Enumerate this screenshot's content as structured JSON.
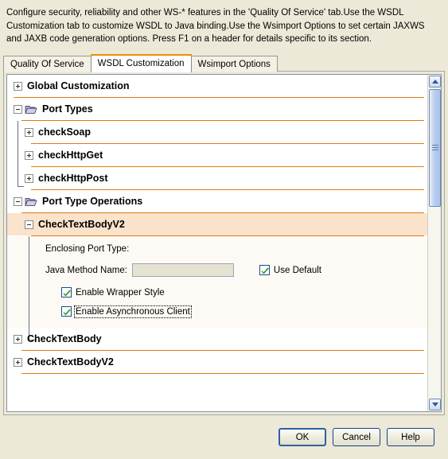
{
  "description": "Configure security, reliability and other WS-* features in the 'Quality Of Service' tab.Use the WSDL Customization tab to customize WSDL to Java binding.Use the Wsimport Options to set certain JAXWS and JAXB code generation options. Press F1 on a header for details specific to its section.",
  "tabs": [
    {
      "label": "Quality Of Service",
      "active": false
    },
    {
      "label": "WSDL Customization",
      "active": true
    },
    {
      "label": "Wsimport Options",
      "active": false
    }
  ],
  "tree": {
    "global_customization": "Global Customization",
    "port_types": "Port Types",
    "port_type_children": [
      "checkSoap",
      "checkHttpGet",
      "checkHttpPost"
    ],
    "port_type_operations": "Port Type Operations",
    "selected_operation": "CheckTextBodyV2",
    "operations_after": [
      "CheckTextBody",
      "CheckTextBodyV2"
    ]
  },
  "detail": {
    "enclosing_port_type_label": "Enclosing Port Type:",
    "enclosing_port_type_value": "",
    "java_method_name_label": "Java Method Name:",
    "java_method_name_value": "",
    "java_method_name_placeholder": "",
    "use_default_label": "Use Default",
    "use_default_checked": true,
    "enable_wrapper_style_label": "Enable Wrapper Style",
    "enable_wrapper_style_checked": true,
    "enable_async_client_label": "Enable Asynchronous Client",
    "enable_async_client_checked": true
  },
  "buttons": {
    "ok": "OK",
    "cancel": "Cancel",
    "help": "Help"
  },
  "icons": {
    "expand": "plus-icon",
    "collapse": "minus-icon",
    "folder": "folder-icon",
    "check": "check-icon",
    "scroll_up": "chevron-up-icon",
    "scroll_down": "chevron-down-icon"
  },
  "colors": {
    "accent_rule": "#e07c14",
    "active_tab_top": "#ef8c00",
    "selection_bg": "#fbe2cb",
    "window_bg": "#ece9d8",
    "detail_bg": "#fdfaf5",
    "check_green": "#2f9e2f",
    "scrollbar_blue": "#aac3ea"
  }
}
